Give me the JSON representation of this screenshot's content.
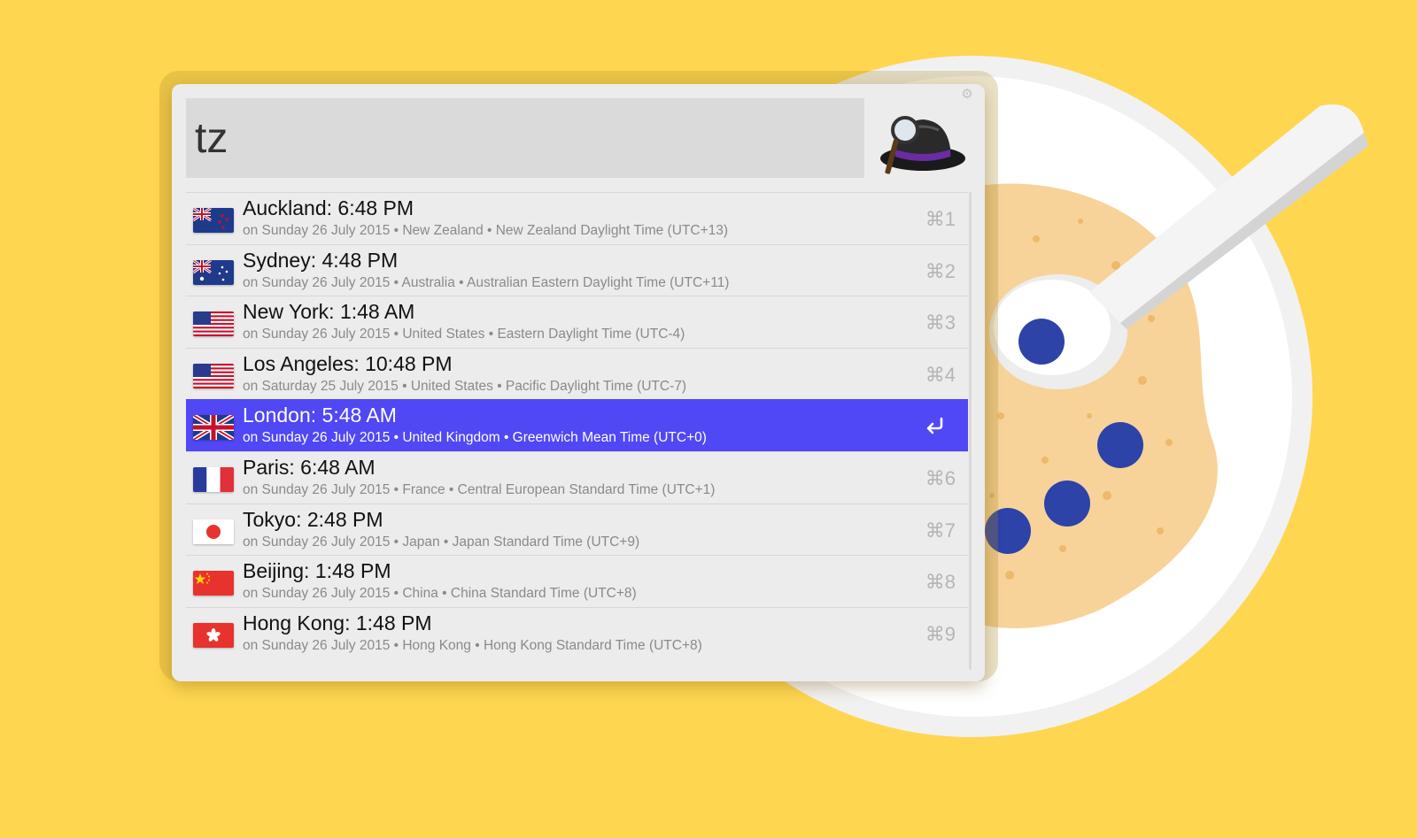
{
  "search": {
    "query": "tz"
  },
  "icons": {
    "app": "alfred-hat-icon",
    "settings": "gear-icon",
    "return": "return-icon"
  },
  "colors": {
    "background": "#FED650",
    "selection": "#5047F5"
  },
  "results": [
    {
      "flag": "new-zealand",
      "title": "Auckland: 6:48 PM",
      "subtitle": "on Sunday 26 July 2015  •  New Zealand • New Zealand Daylight Time (UTC+13)",
      "shortcut": "⌘1",
      "selected": false
    },
    {
      "flag": "australia",
      "title": "Sydney: 4:48 PM",
      "subtitle": "on Sunday 26 July 2015  •  Australia • Australian Eastern Daylight Time (UTC+11)",
      "shortcut": "⌘2",
      "selected": false
    },
    {
      "flag": "united-states",
      "title": "New York: 1:48 AM",
      "subtitle": "on Sunday 26 July 2015  •  United States • Eastern Daylight Time (UTC-4)",
      "shortcut": "⌘3",
      "selected": false
    },
    {
      "flag": "united-states",
      "title": "Los Angeles: 10:48 PM",
      "subtitle": "on Saturday 25 July 2015  •  United States • Pacific Daylight Time (UTC-7)",
      "shortcut": "⌘4",
      "selected": false
    },
    {
      "flag": "united-kingdom",
      "title": "London: 5:48 AM",
      "subtitle": "on Sunday 26 July 2015  •  United Kingdom • Greenwich Mean Time (UTC+0)",
      "shortcut": "",
      "selected": true
    },
    {
      "flag": "france",
      "title": "Paris: 6:48 AM",
      "subtitle": "on Sunday 26 July 2015  •  France • Central European Standard Time (UTC+1)",
      "shortcut": "⌘6",
      "selected": false
    },
    {
      "flag": "japan",
      "title": "Tokyo: 2:48 PM",
      "subtitle": "on Sunday 26 July 2015  •  Japan • Japan Standard Time (UTC+9)",
      "shortcut": "⌘7",
      "selected": false
    },
    {
      "flag": "china",
      "title": "Beijing: 1:48 PM",
      "subtitle": "on Sunday 26 July 2015  •  China • China Standard Time (UTC+8)",
      "shortcut": "⌘8",
      "selected": false
    },
    {
      "flag": "hong-kong",
      "title": "Hong Kong: 1:48 PM",
      "subtitle": "on Sunday 26 July 2015  •  Hong Kong • Hong Kong Standard Time (UTC+8)",
      "shortcut": "⌘9",
      "selected": false
    }
  ]
}
